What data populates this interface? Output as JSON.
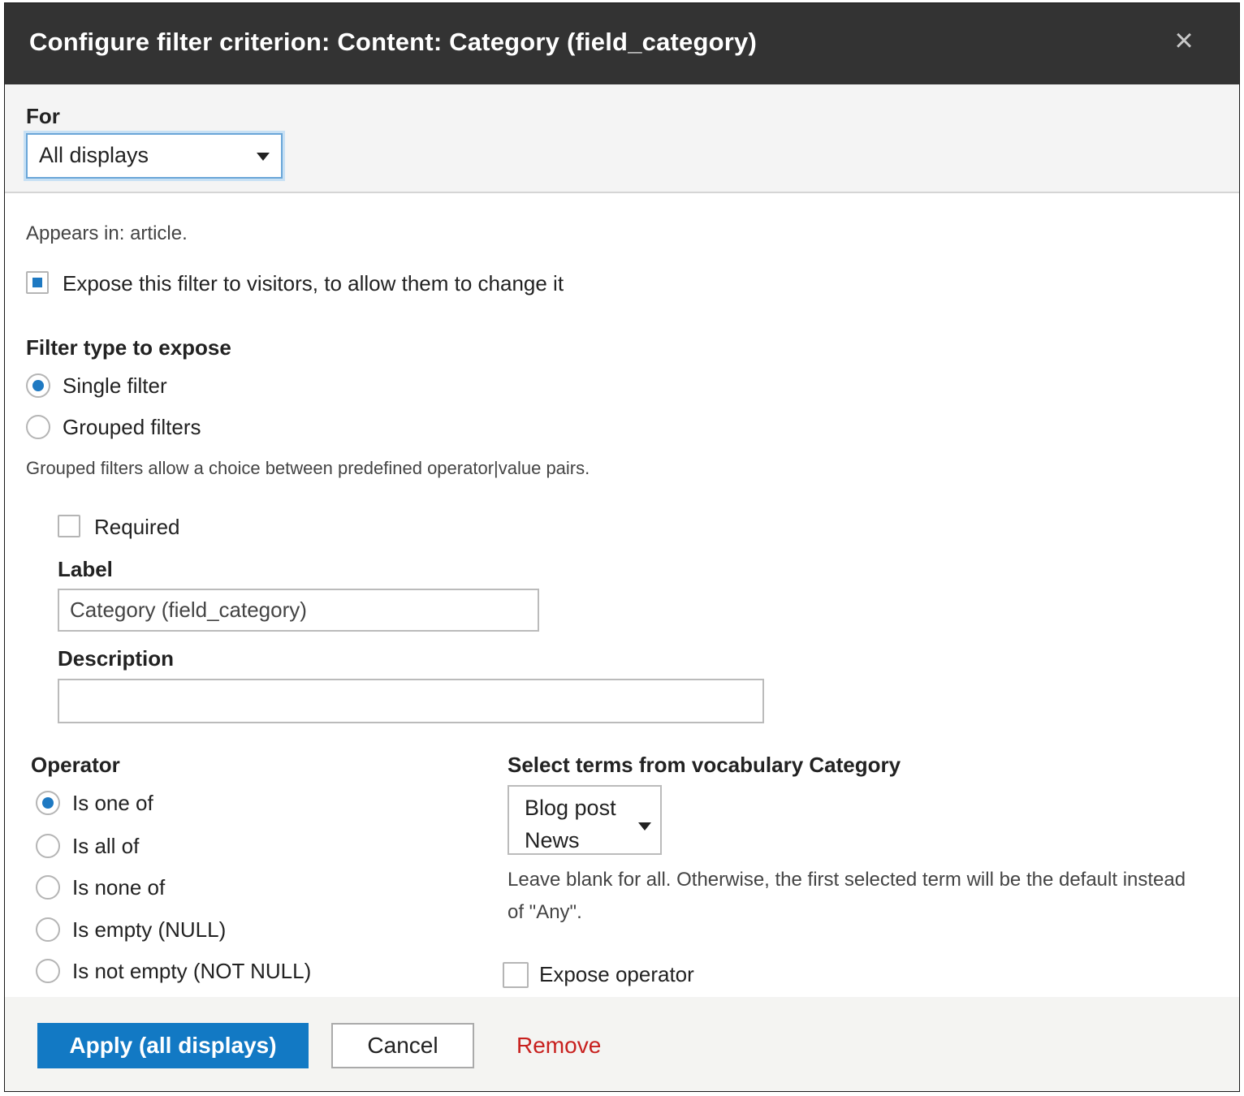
{
  "dialog": {
    "title": "Configure filter criterion: Content: Category (field_category)",
    "close_symbol": "×"
  },
  "for_section": {
    "label": "For",
    "selected": "All displays"
  },
  "appears_in": "Appears in: article.",
  "expose": {
    "label": "Expose this filter to visitors, to allow them to change it",
    "checked": true
  },
  "filter_type": {
    "heading": "Filter type to expose",
    "options": [
      {
        "label": "Single filter",
        "checked": true
      },
      {
        "label": "Grouped filters",
        "checked": false
      }
    ],
    "help": "Grouped filters allow a choice between predefined operator|value pairs."
  },
  "required": {
    "label": "Required",
    "checked": false
  },
  "label_field": {
    "heading": "Label",
    "value": "Category (field_category)"
  },
  "description_field": {
    "heading": "Description",
    "value": ""
  },
  "operator": {
    "heading": "Operator",
    "options": [
      {
        "label": "Is one of",
        "checked": true
      },
      {
        "label": "Is all of",
        "checked": false
      },
      {
        "label": "Is none of",
        "checked": false
      },
      {
        "label": "Is empty (NULL)",
        "checked": false
      },
      {
        "label": "Is not empty (NOT NULL)",
        "checked": false
      }
    ]
  },
  "terms": {
    "heading": "Select terms from vocabulary Category",
    "options": [
      "Blog post",
      "News"
    ],
    "help": "Leave blank for all. Otherwise, the first selected term will be the default instead of \"Any\"."
  },
  "expose_operator": {
    "label": "Expose operator",
    "checked": false
  },
  "footer": {
    "apply_label": "Apply (all displays)",
    "cancel_label": "Cancel",
    "remove_label": "Remove"
  },
  "colors": {
    "titlebar": "#333333",
    "accent": "#1279c4",
    "remove": "#c8201e"
  }
}
